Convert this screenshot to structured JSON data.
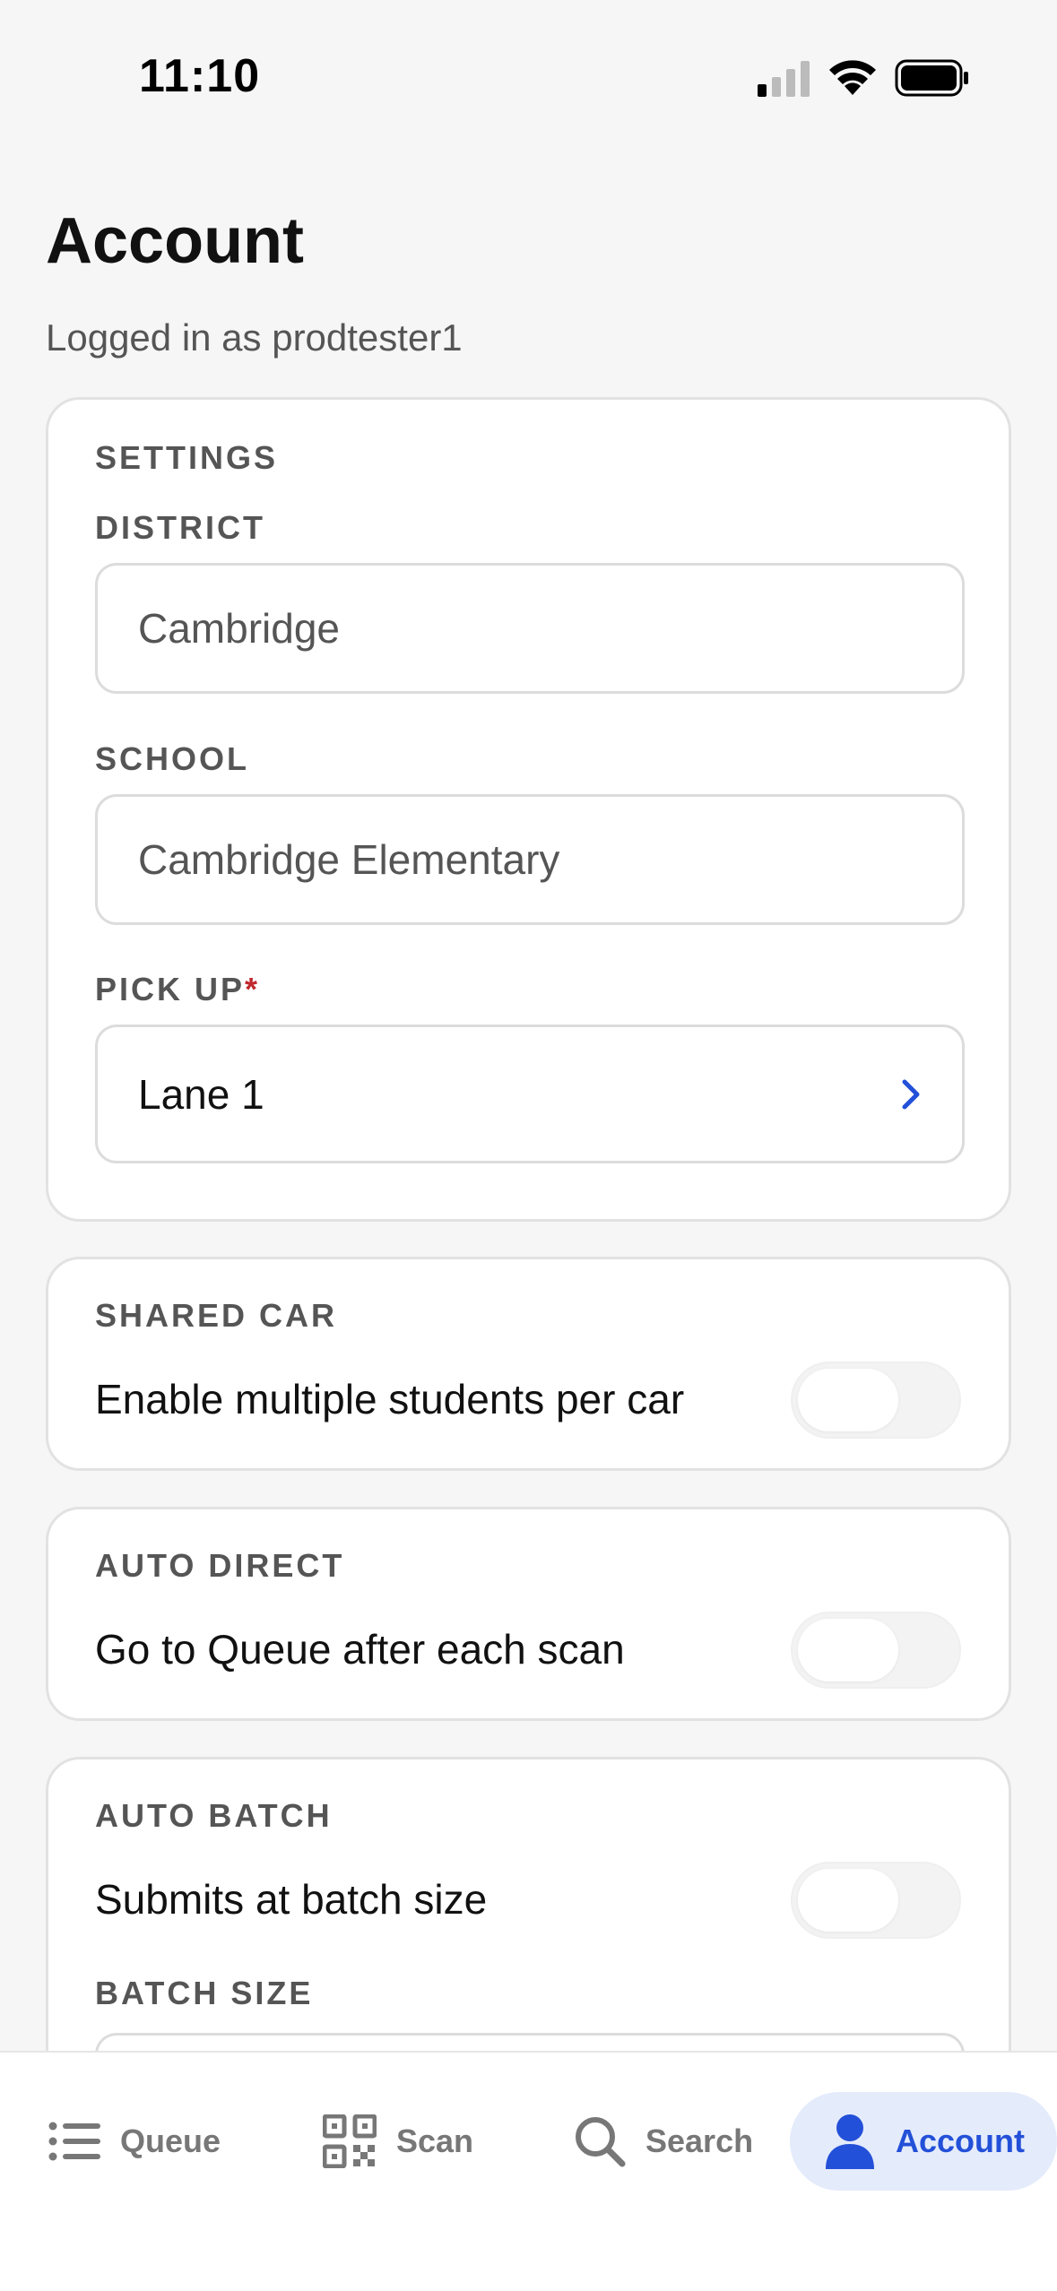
{
  "status_bar": {
    "time": "11:10"
  },
  "header": {
    "title": "Account",
    "subtitle": "Logged in as prodtester1"
  },
  "settings": {
    "section_label": "SETTINGS",
    "district_label": "DISTRICT",
    "district_value": "Cambridge",
    "school_label": "SCHOOL",
    "school_value": "Cambridge Elementary",
    "pickup_label": "PICK UP",
    "pickup_required_mark": "*",
    "pickup_value": "Lane 1"
  },
  "shared_car": {
    "section_label": "SHARED CAR",
    "description": "Enable multiple students per car",
    "enabled": false
  },
  "auto_direct": {
    "section_label": "AUTO DIRECT",
    "description": "Go to Queue after each scan",
    "enabled": false
  },
  "auto_batch": {
    "section_label": "AUTO BATCH",
    "description": "Submits at batch size",
    "enabled": false,
    "batch_size_label": "BATCH SIZE"
  },
  "tabs": [
    {
      "label": "Queue",
      "icon": "list-icon",
      "active": false
    },
    {
      "label": "Scan",
      "icon": "qr-code-icon",
      "active": false
    },
    {
      "label": "Search",
      "icon": "search-icon",
      "active": false
    },
    {
      "label": "Account",
      "icon": "person-icon",
      "active": true
    }
  ],
  "colors": {
    "accent": "#2350d8",
    "active_tab_bg": "#e4ebfb",
    "required": "#c0282d"
  }
}
